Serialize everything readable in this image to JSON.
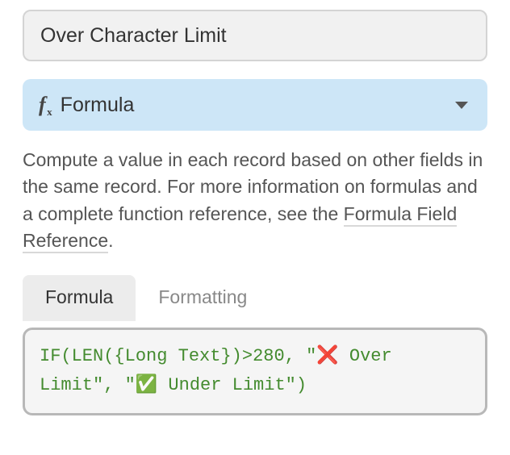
{
  "field_name": {
    "value": "Over Character Limit"
  },
  "type_selector": {
    "icon": "formula-fx-icon",
    "label": "Formula"
  },
  "description": {
    "text_before_link": "Compute a value in each record based on other fields in the same record. For more information on formulas and a complete function reference, see the ",
    "link_text": "Formula Field Reference",
    "text_after_link": "."
  },
  "tabs": {
    "formula": "Formula",
    "formatting": "Formatting",
    "active": "formula"
  },
  "formula": {
    "raw": "IF(LEN({Long Text})>280, \"❌ Over Limit\", \"✅ Under Limit\")",
    "tokens": {
      "fn_if": "IF",
      "open1": "(",
      "fn_len": "LEN",
      "open2": "(",
      "field": "{Long Text}",
      "close2": ")",
      "op_gt": ">",
      "num": "280",
      "comma1": ", ",
      "str1_open": "\"",
      "str1_emoji": "❌",
      "str1_text": " Over Limit",
      "str1_close": "\"",
      "comma2": ", ",
      "str2_open": "\"",
      "str2_emoji": "✅",
      "str2_text": " Under Limit",
      "str2_close": "\"",
      "close1": ")"
    }
  }
}
